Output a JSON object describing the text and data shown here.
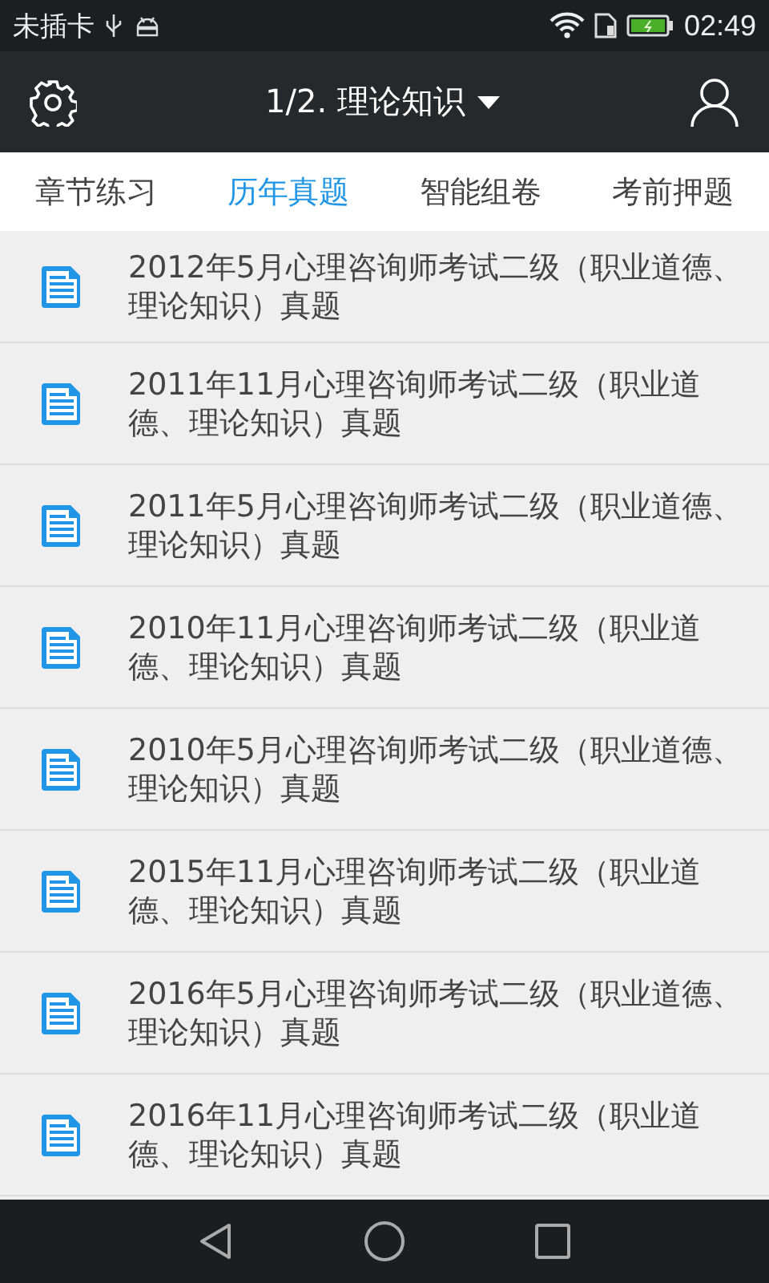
{
  "status_bar": {
    "carrier": "未插卡",
    "time": "02:49"
  },
  "toolbar": {
    "title": "1/2. 理论知识"
  },
  "tabs": [
    {
      "label": "章节练习",
      "selected": false
    },
    {
      "label": "历年真题",
      "selected": true
    },
    {
      "label": "智能组卷",
      "selected": false
    },
    {
      "label": "考前押题",
      "selected": false
    }
  ],
  "papers": [
    {
      "title": "2012年5月心理咨询师考试二级（职业道德、理论知识）真题"
    },
    {
      "title": "2011年11月心理咨询师考试二级（职业道德、理论知识）真题"
    },
    {
      "title": "2011年5月心理咨询师考试二级（职业道德、理论知识）真题"
    },
    {
      "title": "2010年11月心理咨询师考试二级（职业道德、理论知识）真题"
    },
    {
      "title": "2010年5月心理咨询师考试二级（职业道德、理论知识）真题"
    },
    {
      "title": "2015年11月心理咨询师考试二级（职业道德、理论知识）真题"
    },
    {
      "title": "2016年5月心理咨询师考试二级（职业道德、理论知识）真题"
    },
    {
      "title": "2016年11月心理咨询师考试二级（职业道德、理论知识）真题"
    }
  ]
}
